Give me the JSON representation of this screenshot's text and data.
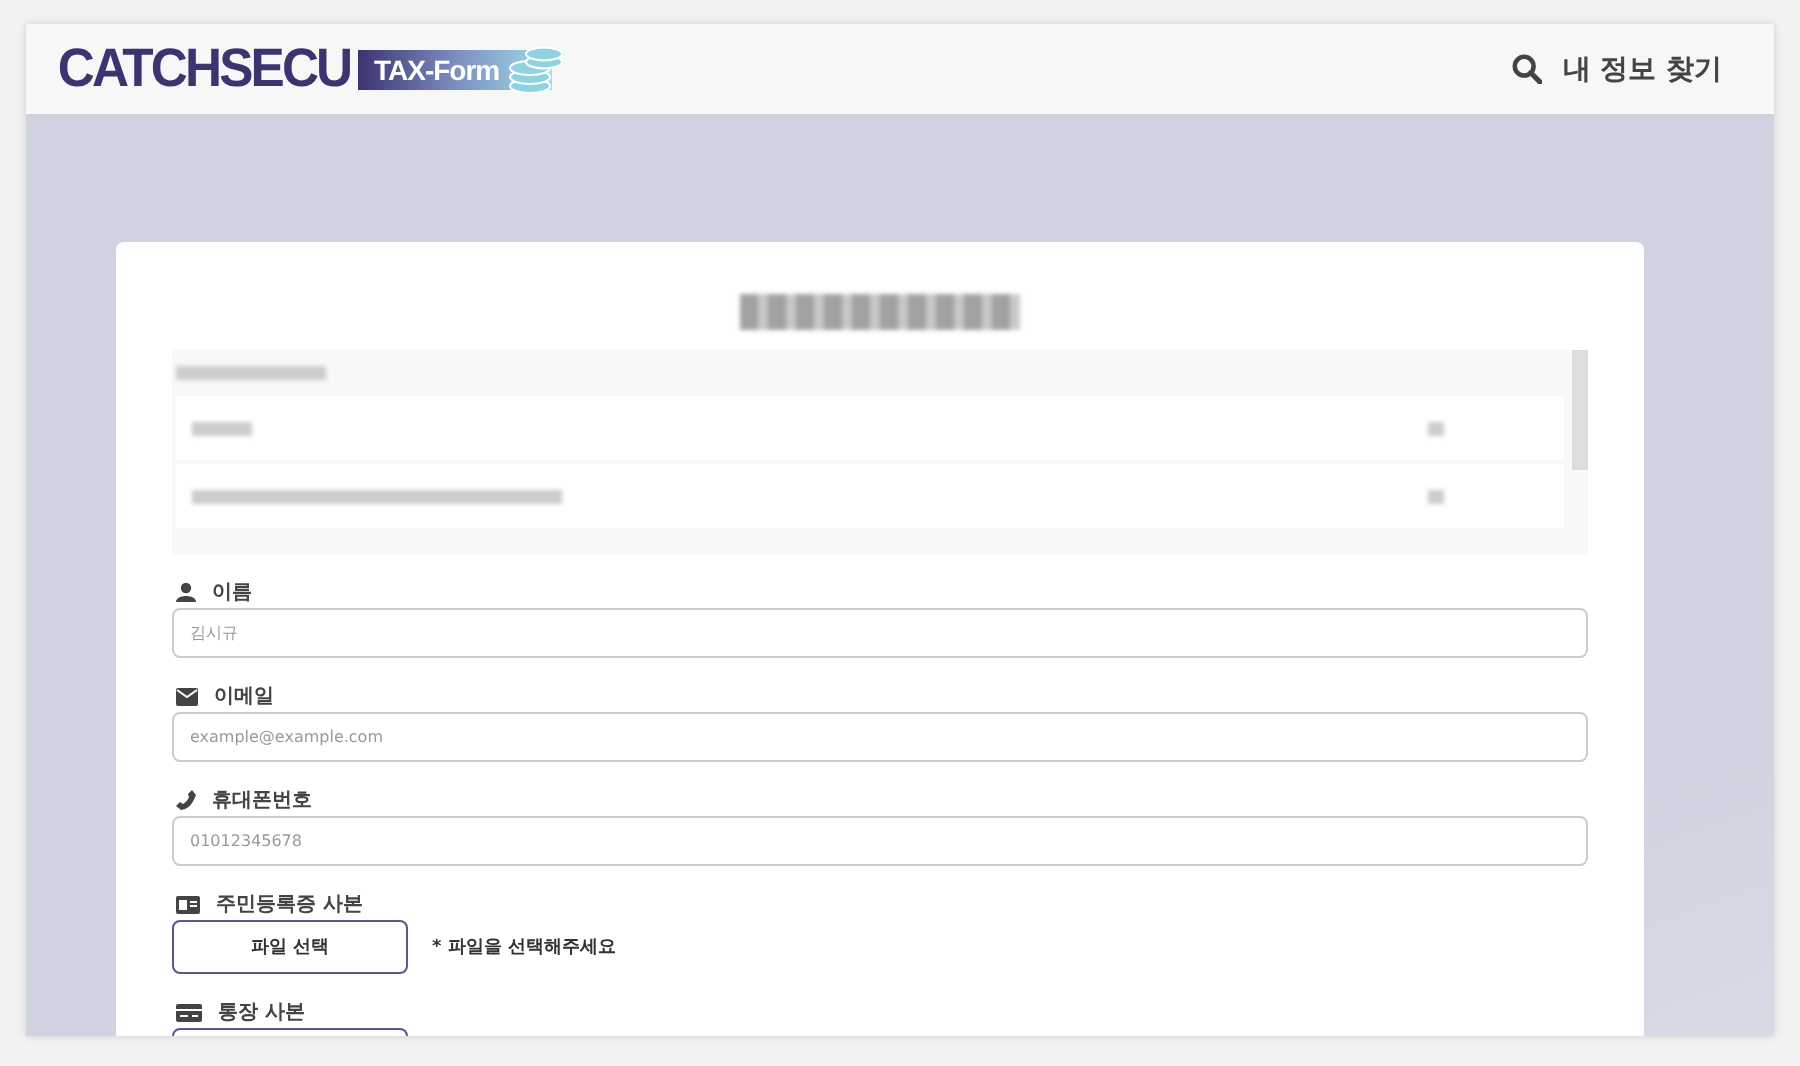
{
  "header": {
    "logo": "CATCHSECU",
    "logo_badge": "TAX-Form",
    "search_link": "내 정보 찾기"
  },
  "form": {
    "fields": [
      {
        "kind": "text",
        "label": "이름",
        "placeholder": "김시규"
      },
      {
        "kind": "text",
        "label": "이메일",
        "placeholder": "example@example.com"
      },
      {
        "kind": "text",
        "label": "휴대폰번호",
        "placeholder": "01012345678"
      },
      {
        "kind": "file",
        "label": "주민등록증 사본",
        "button": "파일 선택",
        "hint": "* 파일을 선택해주세요"
      },
      {
        "kind": "file",
        "label": "통장 사본"
      }
    ]
  }
}
